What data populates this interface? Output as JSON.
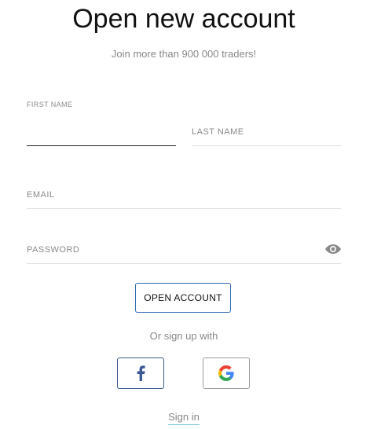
{
  "header": {
    "title": "Open new account",
    "subtitle": "Join more than 900 000 traders!"
  },
  "form": {
    "first_name_label": "FIRST NAME",
    "last_name_label": "LAST NAME",
    "email_label": "EMAIL",
    "password_label": "PASSWORD",
    "password_toggle_icon": "eye-icon"
  },
  "actions": {
    "open_account_label": "OPEN ACCOUNT",
    "or_text": "Or sign up with",
    "facebook_icon": "facebook-icon",
    "google_icon": "google-icon",
    "sign_in_label": "Sign in"
  },
  "colors": {
    "primary_border": "#2f6db0",
    "facebook": "#3b5998",
    "muted_text": "#888888",
    "sign_in_underline": "#7fc7d0"
  }
}
